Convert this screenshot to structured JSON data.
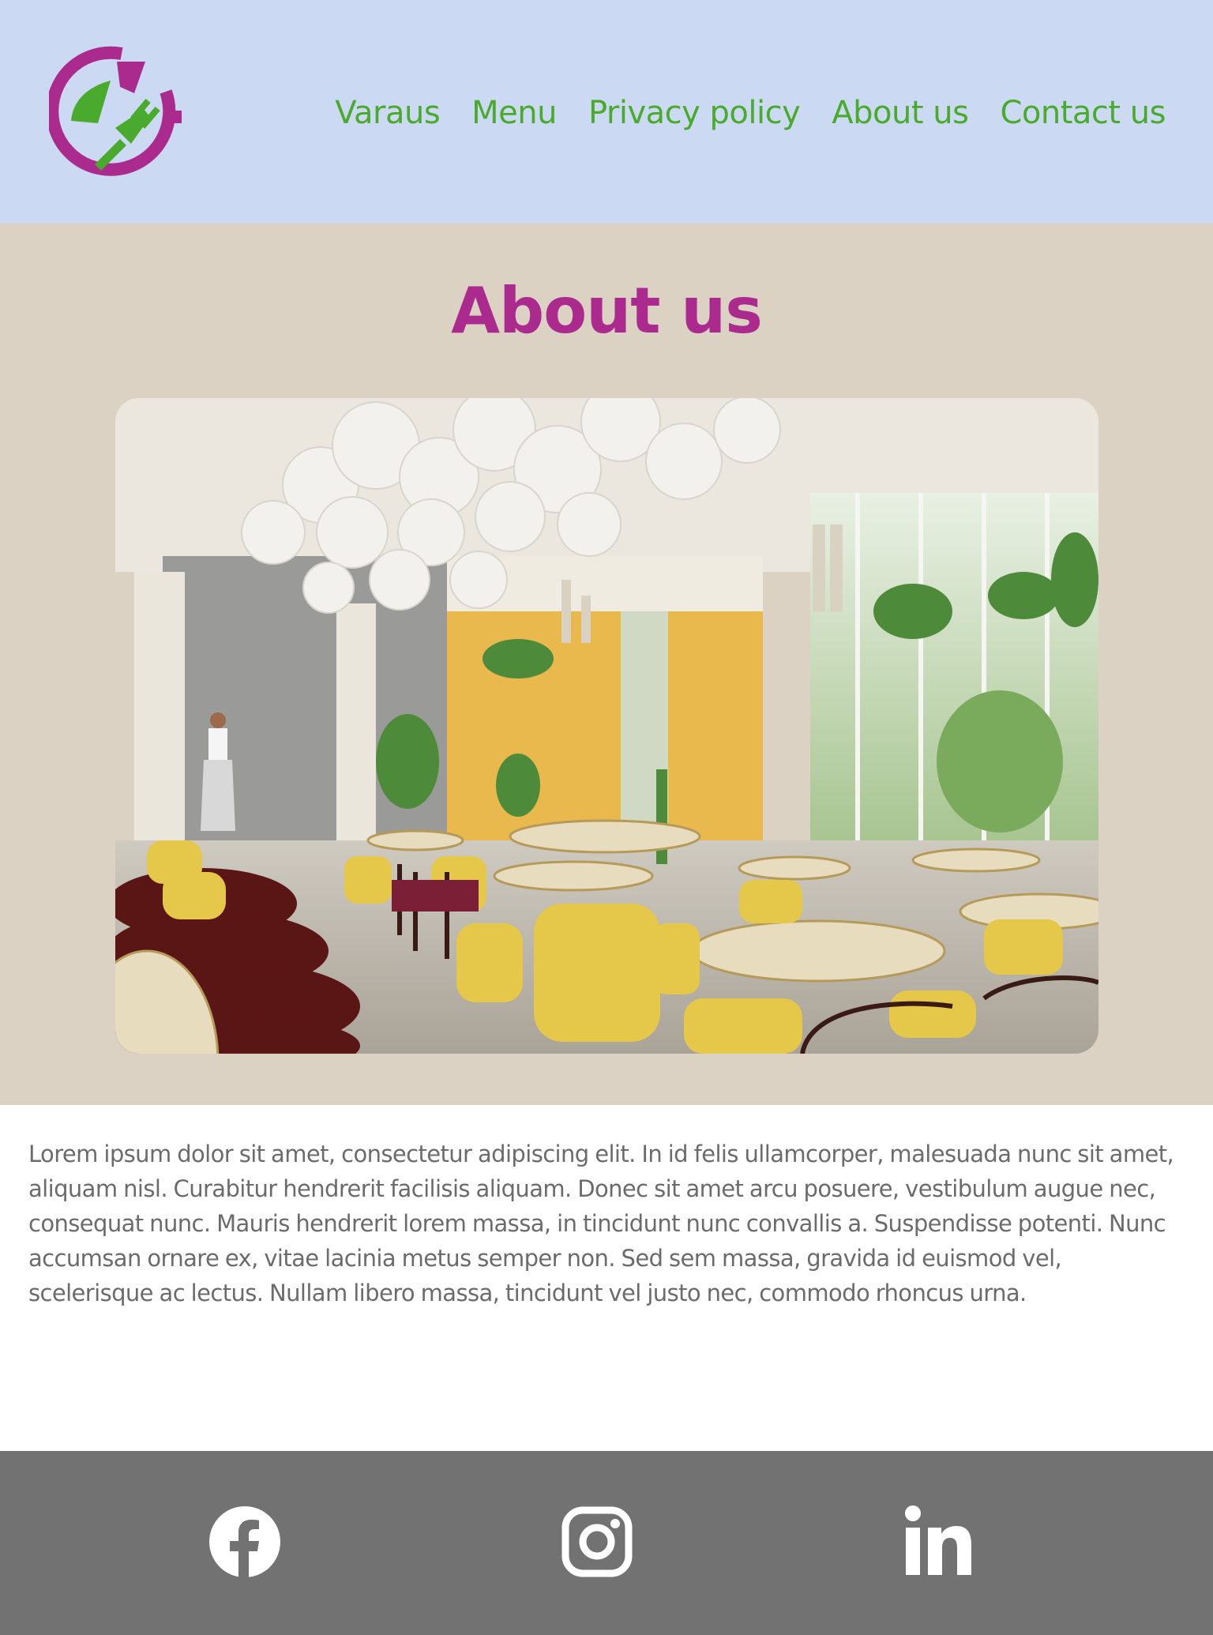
{
  "header": {
    "logo_icon": "plate-utensils-logo",
    "nav": [
      {
        "label": "Varaus"
      },
      {
        "label": "Menu"
      },
      {
        "label": "Privacy policy"
      },
      {
        "label": "About us"
      },
      {
        "label": "Contact us"
      }
    ]
  },
  "hero": {
    "title": "About us",
    "image_icon": "restaurant-interior-photo"
  },
  "content": {
    "paragraph": "Lorem ipsum dolor sit amet, consectetur adipiscing elit. In id felis ullamcorper, malesuada nunc sit amet, aliquam nisl. Curabitur hendrerit facilisis aliquam. Donec sit amet arcu posuere, vestibulum augue nec, consequat nunc. Mauris hendrerit lorem massa, in tincidunt nunc convallis a. Suspendisse potenti. Nunc accumsan ornare ex, vitae lacinia metus semper non. Sed sem massa, gravida id euismod vel, scelerisque ac lectus. Nullam libero massa, tincidunt vel justo nec, commodo rhoncus urna."
  },
  "footer": {
    "social": [
      {
        "icon": "facebook-icon"
      },
      {
        "icon": "instagram-icon"
      },
      {
        "icon": "linkedin-icon"
      }
    ]
  },
  "colors": {
    "header_bg": "#cbdaf2",
    "nav_text": "#4aaa2e",
    "hero_bg": "#dcd2c4",
    "title": "#ab2a8e",
    "body_text": "#6b6b6b",
    "footer_bg": "#727272"
  }
}
